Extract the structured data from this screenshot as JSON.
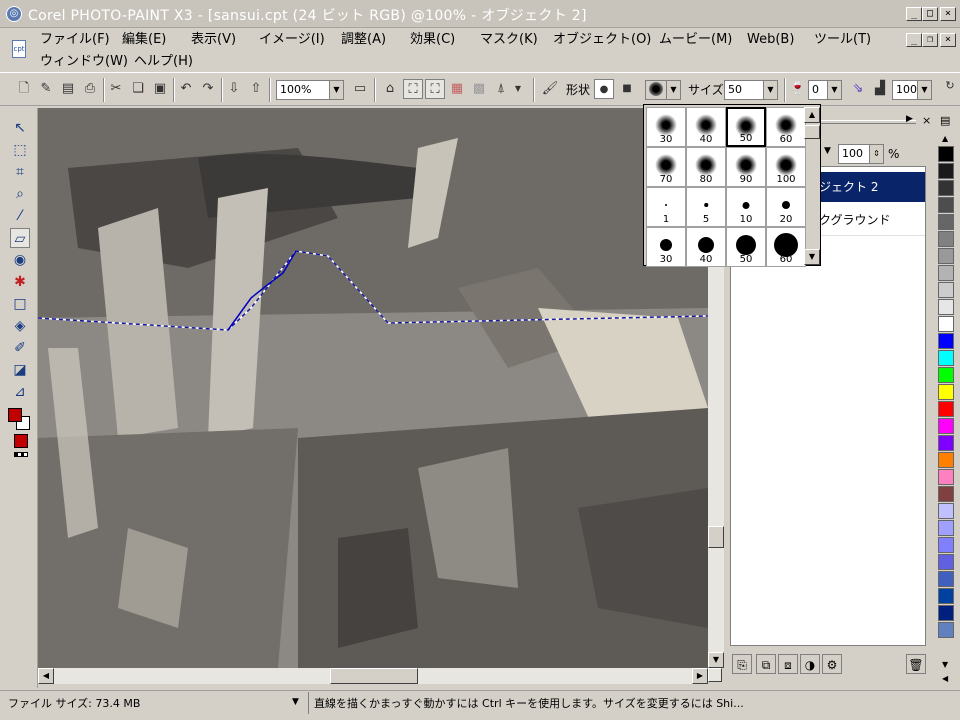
{
  "window": {
    "title": "Corel PHOTO-PAINT X3 - [sansui.cpt (24 ビット RGB) @100% - オブジェクト 2]",
    "app_icon": "corel-app-icon"
  },
  "menu": [
    "ファイル(F)",
    "編集(E)",
    "表示(V)",
    "イメージ(I)",
    "調整(A)",
    "効果(C)",
    "マスク(K)",
    "オブジェクト(O)",
    "ムービー(M)",
    "Web(B)",
    "ツール(T)",
    "ウィンドウ(W)",
    "ヘルプ(H)"
  ],
  "toolbar": {
    "zoom": "100%",
    "shape_label": "形状",
    "size_label": "サイズ",
    "size_value": "50",
    "transparency_value": "0",
    "opacity_value": "100"
  },
  "brush_sizes": [
    {
      "n": "30",
      "kind": "soft"
    },
    {
      "n": "40",
      "kind": "soft"
    },
    {
      "n": "50",
      "kind": "soft",
      "selected": true
    },
    {
      "n": "60",
      "kind": "soft"
    },
    {
      "n": "70",
      "kind": "soft"
    },
    {
      "n": "80",
      "kind": "soft"
    },
    {
      "n": "90",
      "kind": "soft"
    },
    {
      "n": "100",
      "kind": "soft"
    },
    {
      "n": "1",
      "kind": "hard"
    },
    {
      "n": "5",
      "kind": "hard"
    },
    {
      "n": "10",
      "kind": "hard"
    },
    {
      "n": "20",
      "kind": "hard"
    },
    {
      "n": "30",
      "kind": "hard"
    },
    {
      "n": "40",
      "kind": "hard"
    },
    {
      "n": "50",
      "kind": "hard"
    },
    {
      "n": "60",
      "kind": "hard"
    }
  ],
  "docker": {
    "opacity": "100",
    "percent": "%",
    "objects": [
      "ジェクト 2",
      "クグラウンド"
    ]
  },
  "palette": [
    "#000000",
    "#1a1a1a",
    "#333333",
    "#4d4d4d",
    "#666666",
    "#808080",
    "#999999",
    "#b3b3b3",
    "#cccccc",
    "#e6e6e6",
    "#ffffff",
    "#0000ff",
    "#00ffff",
    "#00ff00",
    "#ffff00",
    "#ff0000",
    "#ff00ff",
    "#8000ff",
    "#ff8000",
    "#ff80c0",
    "#804040",
    "#c0c0ff",
    "#a0a0ff",
    "#8080ff",
    "#6060e0",
    "#4060c0",
    "#0040a0",
    "#002080",
    "#6080c0"
  ],
  "status": {
    "file_size": "ファイル サイズ: 73.4 MB",
    "hint": "直線を描くかまっすぐ動かすには Ctrl キーを使用します。サイズを変更するには Shi..."
  }
}
